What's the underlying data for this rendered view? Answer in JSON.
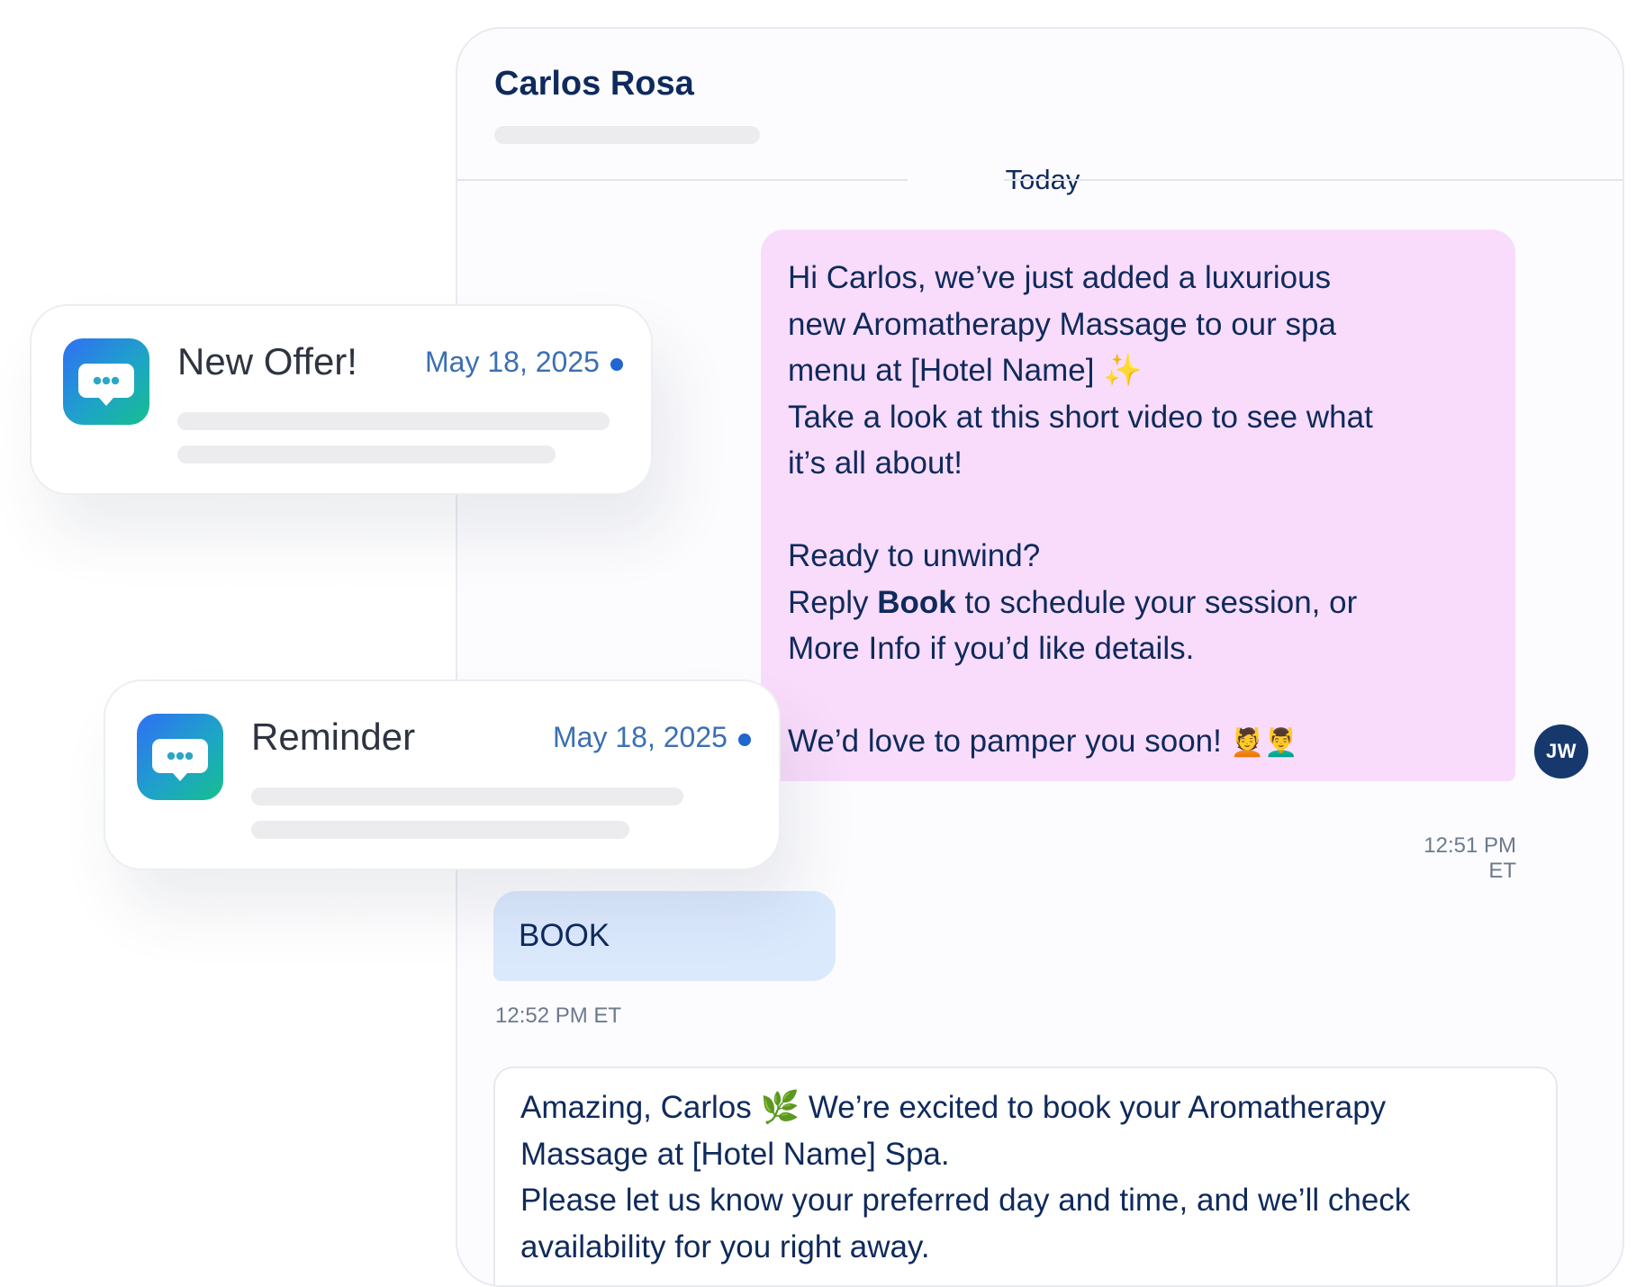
{
  "conversation": {
    "contact_name": "Carlos Rosa",
    "date_divider": "Today",
    "outgoing_message": {
      "line1": "Hi Carlos, we’ve just added a luxurious",
      "line2": "new Aromatherapy Massage to our spa",
      "line3": "menu at [Hotel Name]",
      "line3_emoji": "✨",
      "line4": "Take a look at this short video to see what",
      "line5": "it’s all about!",
      "line6": "Ready to unwind?",
      "line7_pre": "Reply ",
      "line7_bold": "Book",
      "line7_post": " to schedule your session, or",
      "line8": "More Info if you’d like details.",
      "line9": "We’d love to pamper you soon!",
      "line9_emoji": "💆💆‍♂️",
      "sender_initials": "JW",
      "time": "12:51 PM ET"
    },
    "incoming_message": {
      "text": "BOOK",
      "time": "12:52 PM ET"
    },
    "draft_reply": {
      "line1_pre": "Amazing, Carlos",
      "line1_emoji": "🌿",
      "line1_post": "We’re excited to book your Aromatherapy",
      "line2": "Massage at [Hotel Name] Spa.",
      "line3": "Please let us know your preferred day and time, and we’ll check",
      "line4": "availability for you right away."
    }
  },
  "notifications": [
    {
      "title": "New Offer!",
      "date": "May 18, 2025",
      "icon": "chat-bubble-icon"
    },
    {
      "title": "Reminder",
      "date": "May 18, 2025",
      "icon": "chat-bubble-icon"
    }
  ],
  "colors": {
    "outgoing_bubble": "#f9dcfb",
    "incoming_bubble": "#dbe9fd",
    "text_navy": "#0f2a5c",
    "date_blue": "#3b6fb3",
    "unread_dot": "#1f66d1",
    "avatar_bg": "#17386d"
  }
}
